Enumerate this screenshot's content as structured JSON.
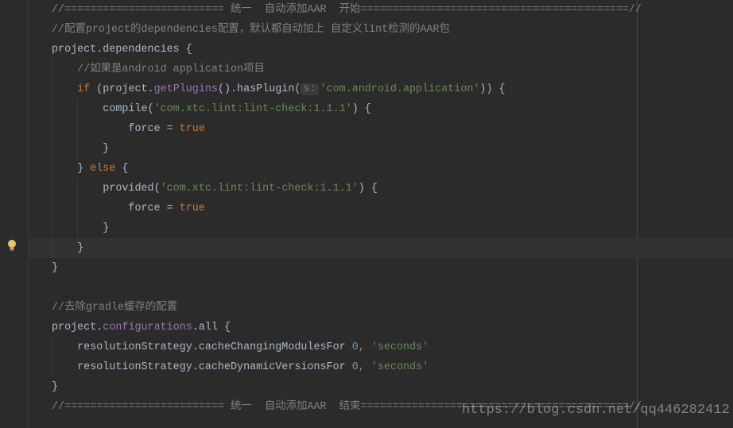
{
  "colors": {
    "background": "#2b2b2b",
    "comment": "#808080",
    "keyword": "#cc7832",
    "property": "#9876aa",
    "string": "#6a8759",
    "number": "#6897bb",
    "text": "#a9b7c6",
    "current_line": "#323232"
  },
  "current_line_index": 12,
  "gutter_icon": "lightbulb-icon",
  "watermark": "https://blog.csdn.net/qq446282412",
  "lines": [
    [
      [
        "comment",
        "//========================= 统一  自动添加AAR  开始==========================================//"
      ]
    ],
    [
      [
        "comment",
        "//配置project的dependencies配置，默认都自动加上 自定义lint检测的AAR包"
      ]
    ],
    [
      [
        "text",
        "project.dependencies {"
      ]
    ],
    [
      [
        "text",
        "    "
      ],
      [
        "comment",
        "//如果是android application项目"
      ]
    ],
    [
      [
        "text",
        "    "
      ],
      [
        "kw",
        "if "
      ],
      [
        "text",
        "(project."
      ],
      [
        "prop",
        "getPlugins"
      ],
      [
        "text",
        "().hasPlugin("
      ],
      [
        "hint",
        "s:"
      ],
      [
        "str",
        "'com.android.application'"
      ],
      [
        "text",
        ")) {"
      ]
    ],
    [
      [
        "text",
        "        compile("
      ],
      [
        "str",
        "'com.xtc.lint:lint-check:1.1.1'"
      ],
      [
        "text",
        ") {"
      ]
    ],
    [
      [
        "text",
        "            force = "
      ],
      [
        "kw",
        "true"
      ]
    ],
    [
      [
        "text",
        "        }"
      ]
    ],
    [
      [
        "text",
        "    } "
      ],
      [
        "kw",
        "else "
      ],
      [
        "text",
        "{"
      ]
    ],
    [
      [
        "text",
        "        provided("
      ],
      [
        "str",
        "'com.xtc.lint:lint-check:1.1.1'"
      ],
      [
        "text",
        ") {"
      ]
    ],
    [
      [
        "text",
        "            force = "
      ],
      [
        "kw",
        "true"
      ]
    ],
    [
      [
        "text",
        "        }"
      ]
    ],
    [
      [
        "text",
        "    }"
      ]
    ],
    [
      [
        "text",
        "}"
      ]
    ],
    [
      [
        "text",
        ""
      ]
    ],
    [
      [
        "comment",
        "//去除gradle缓存的配置"
      ]
    ],
    [
      [
        "text",
        "project."
      ],
      [
        "prop",
        "configurations"
      ],
      [
        "text",
        ".all {"
      ]
    ],
    [
      [
        "text",
        "    resolutionStrategy.cacheChangingModulesFor "
      ],
      [
        "num",
        "0"
      ],
      [
        "kw",
        ", "
      ],
      [
        "str",
        "'seconds'"
      ]
    ],
    [
      [
        "text",
        "    resolutionStrategy.cacheDynamicVersionsFor "
      ],
      [
        "num",
        "0"
      ],
      [
        "kw",
        ", "
      ],
      [
        "str",
        "'seconds'"
      ]
    ],
    [
      [
        "text",
        "}"
      ]
    ],
    [
      [
        "comment",
        "//========================= 统一  自动添加AAR  结束==========================================//"
      ]
    ]
  ]
}
